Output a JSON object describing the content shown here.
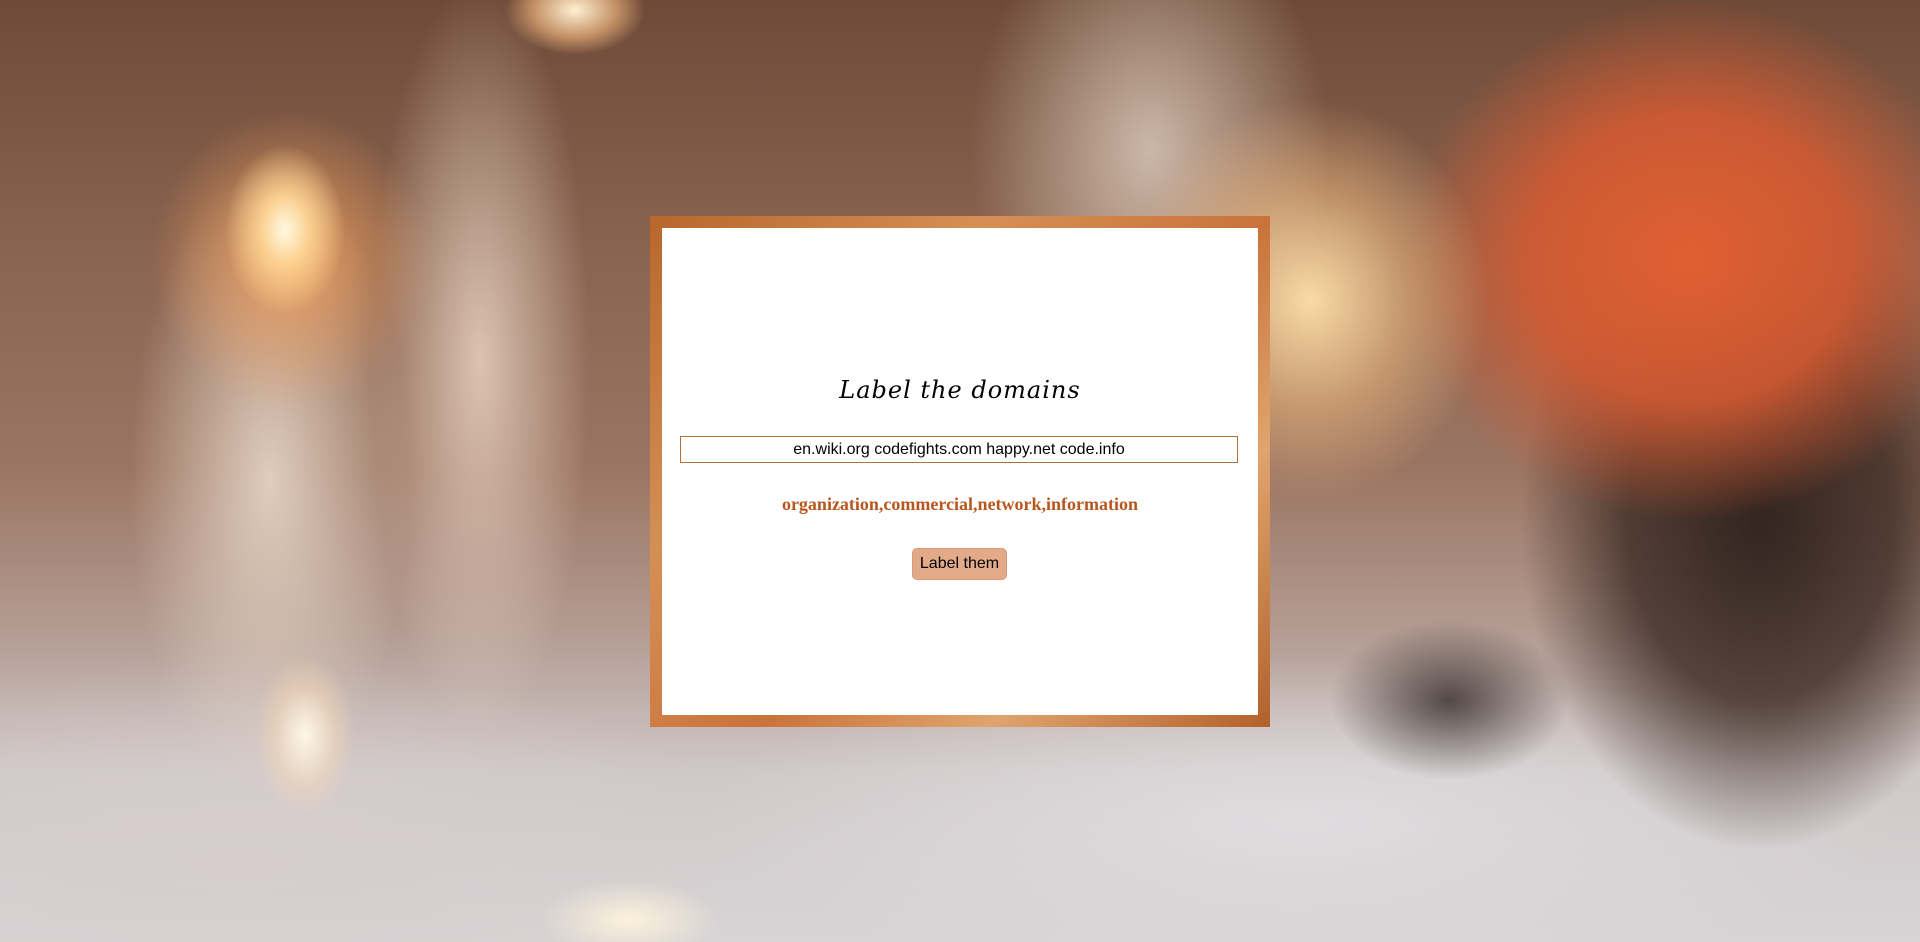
{
  "page": {
    "title": "Label the domains",
    "accent_color": "#b8561e",
    "frame_color": "#c9733a"
  },
  "form": {
    "input_value": "en.wiki.org codefights.com happy.net code.info",
    "result_text": "organization,commercial,network,information",
    "button_label": "Label them",
    "button_color": "#e3aa89"
  }
}
